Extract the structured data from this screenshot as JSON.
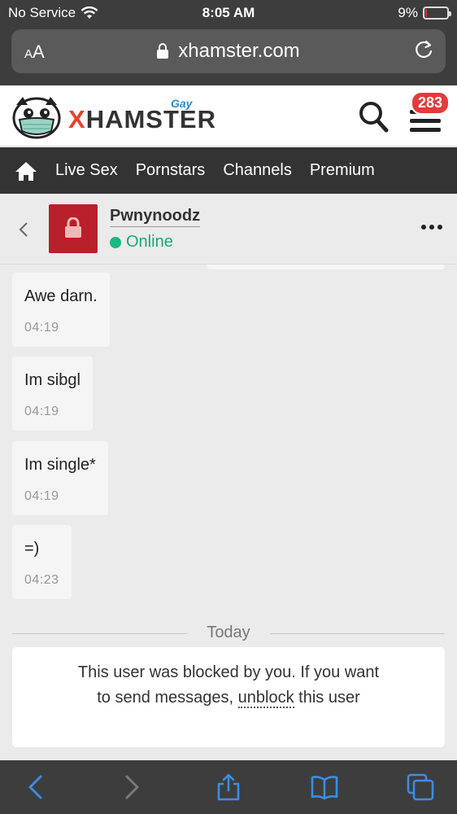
{
  "status_bar": {
    "carrier": "No Service",
    "time": "8:05 AM",
    "battery": "9%",
    "battery_level": 0.09
  },
  "browser": {
    "text_size_label": "AA",
    "url": "xhamster.com"
  },
  "site": {
    "brand_tag": "Gay",
    "brand_name_x": "X",
    "brand_name_rest": "HAMSTER",
    "notification_count": "283",
    "nav": [
      "Live Sex",
      "Pornstars",
      "Channels",
      "Premium"
    ]
  },
  "chat": {
    "username": "Pwnynoodz",
    "status": "Online",
    "messages": [
      {
        "text": "Awe darn.",
        "time": "04:19"
      },
      {
        "text": "Im sibgl",
        "time": "04:19"
      },
      {
        "text": "Im single*",
        "time": "04:19"
      },
      {
        "text": "=)",
        "time": "04:23"
      }
    ],
    "day_divider": "Today",
    "blocked_notice": {
      "before": "This user was blocked by you. If you want to send messages,",
      "link": "unblock",
      "after": "this user"
    }
  },
  "colors": {
    "accent_red": "#e8412d",
    "online_green": "#19b985",
    "safari_blue": "#3a8ee6",
    "badge_red": "#e23b3b"
  },
  "icons": [
    "wifi-icon",
    "lock-icon",
    "reload-icon",
    "search-icon",
    "menu-icon",
    "home-icon",
    "back-chevron-icon",
    "more-icon",
    "share-icon",
    "bookmarks-icon",
    "tabs-icon"
  ]
}
